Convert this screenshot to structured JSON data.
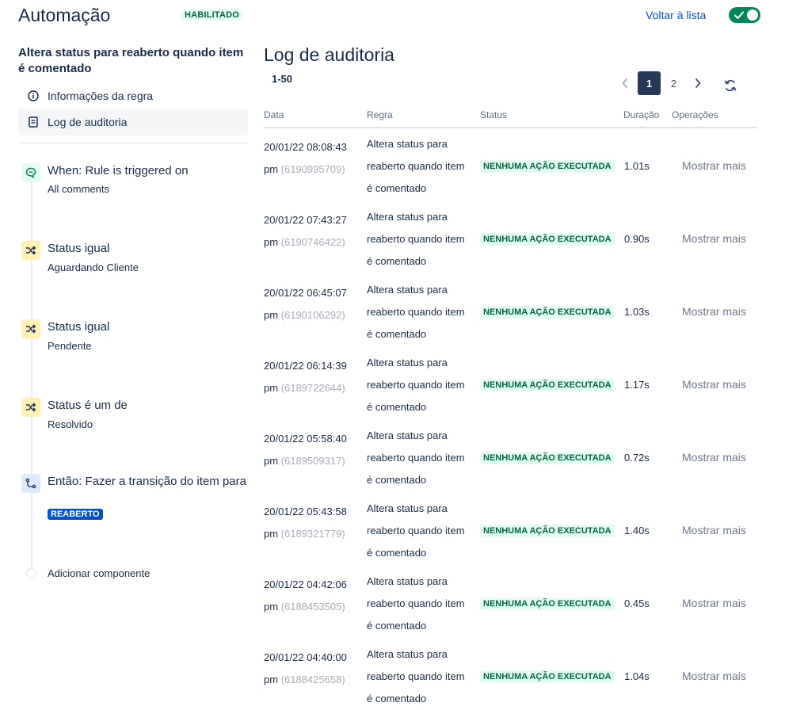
{
  "header": {
    "title": "Automação",
    "status_badge": "HABILITADO",
    "back_link": "Voltar à lista",
    "toggle_on": true
  },
  "sidebar": {
    "rule_name": "Altera status para reaberto quando item é comentado",
    "nav": [
      {
        "label": "Informações da regra",
        "icon": "info-icon",
        "active": false
      },
      {
        "label": "Log de auditoria",
        "icon": "document-icon",
        "active": true
      }
    ],
    "components": {
      "trigger": {
        "title": "When: Rule is triggered on",
        "subtitle": "All comments",
        "icon": "comment-icon"
      },
      "condition1": {
        "title": "Status igual",
        "subtitle": "Aguardando Cliente",
        "icon": "shuffle-icon"
      },
      "condition2": {
        "title": "Status igual",
        "subtitle": "Pendente",
        "icon": "shuffle-icon"
      },
      "condition3": {
        "title": "Status é um de",
        "subtitle": "Resolvido",
        "icon": "shuffle-icon"
      },
      "action": {
        "title": "Então: Fazer a transição do item para",
        "lozenge": "REABERTO",
        "icon": "transition-icon"
      }
    },
    "add_component": "Adicionar componente"
  },
  "main": {
    "title": "Log de auditoria",
    "range": "1-50",
    "pagination": {
      "pages": [
        "1",
        "2"
      ],
      "current": "1"
    },
    "columns": [
      "Data",
      "Regra",
      "Status",
      "Duração",
      "Operações"
    ],
    "rows": [
      {
        "date": "20/01/22 08:08:43",
        "ampm": "pm",
        "id": "(6190995709)",
        "rule": "Altera status para reaberto quando item é comentado",
        "status": "NENHUMA AÇÃO EXECUTADA",
        "duration": "1.01s",
        "op": "Mostrar mais"
      },
      {
        "date": "20/01/22 07:43:27",
        "ampm": "pm",
        "id": "(6190746422)",
        "rule": "Altera status para reaberto quando item é comentado",
        "status": "NENHUMA AÇÃO EXECUTADA",
        "duration": "0.90s",
        "op": "Mostrar mais"
      },
      {
        "date": "20/01/22 06:45:07",
        "ampm": "pm",
        "id": "(6190106292)",
        "rule": "Altera status para reaberto quando item é comentado",
        "status": "NENHUMA AÇÃO EXECUTADA",
        "duration": "1.03s",
        "op": "Mostrar mais"
      },
      {
        "date": "20/01/22 06:14:39",
        "ampm": "pm",
        "id": "(6189722644)",
        "rule": "Altera status para reaberto quando item é comentado",
        "status": "NENHUMA AÇÃO EXECUTADA",
        "duration": "1.17s",
        "op": "Mostrar mais"
      },
      {
        "date": "20/01/22 05:58:40",
        "ampm": "pm",
        "id": "(6189509317)",
        "rule": "Altera status para reaberto quando item é comentado",
        "status": "NENHUMA AÇÃO EXECUTADA",
        "duration": "0.72s",
        "op": "Mostrar mais"
      },
      {
        "date": "20/01/22 05:43:58",
        "ampm": "pm",
        "id": "(6189321779)",
        "rule": "Altera status para reaberto quando item é comentado",
        "status": "NENHUMA AÇÃO EXECUTADA",
        "duration": "1.40s",
        "op": "Mostrar mais"
      },
      {
        "date": "20/01/22 04:42:06",
        "ampm": "pm",
        "id": "(6188453505)",
        "rule": "Altera status para reaberto quando item é comentado",
        "status": "NENHUMA AÇÃO EXECUTADA",
        "duration": "0.45s",
        "op": "Mostrar mais"
      },
      {
        "date": "20/01/22 04:40:00",
        "ampm": "pm",
        "id": "(6188425658)",
        "rule": "Altera status para reaberto quando item é comentado",
        "status": "NENHUMA AÇÃO EXECUTADA",
        "duration": "1.04s",
        "op": "Mostrar mais"
      }
    ]
  },
  "colors": {
    "accent": "#0052cc",
    "success_bg": "#e3fcef",
    "success_text": "#006644",
    "toggle": "#00875a",
    "text": "#172b4d",
    "muted": "#6b778c"
  }
}
